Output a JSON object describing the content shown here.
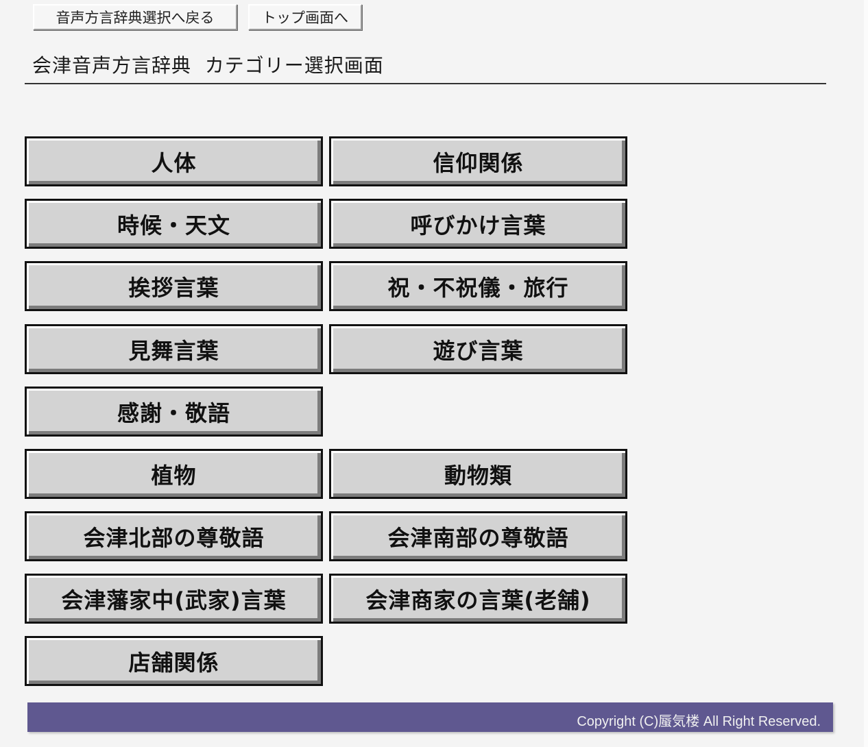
{
  "nav": {
    "back_label": "音声方言辞典選択へ戻る",
    "top_label": "トップ画面へ"
  },
  "page_title": "会津音声方言辞典  カテゴリー選択画面",
  "categories": [
    "人体",
    "信仰関係",
    "時候・天文",
    "呼びかけ言葉",
    "挨拶言葉",
    "祝・不祝儀・旅行",
    "見舞言葉",
    "遊び言葉",
    "感謝・敬語",
    "植物",
    "動物類",
    "会津北部の尊敬語",
    "会津南部の尊敬語",
    "会津藩家中(武家)言葉",
    "会津商家の言葉(老舗)",
    "店舗関係"
  ],
  "footer": {
    "copyright": "Copyright (C)蜃気楼  All Right Reserved."
  },
  "colors": {
    "footer_bg": "#5f5890",
    "button_face": "#d3d3d3",
    "page_bg": "#f4f4f4"
  }
}
